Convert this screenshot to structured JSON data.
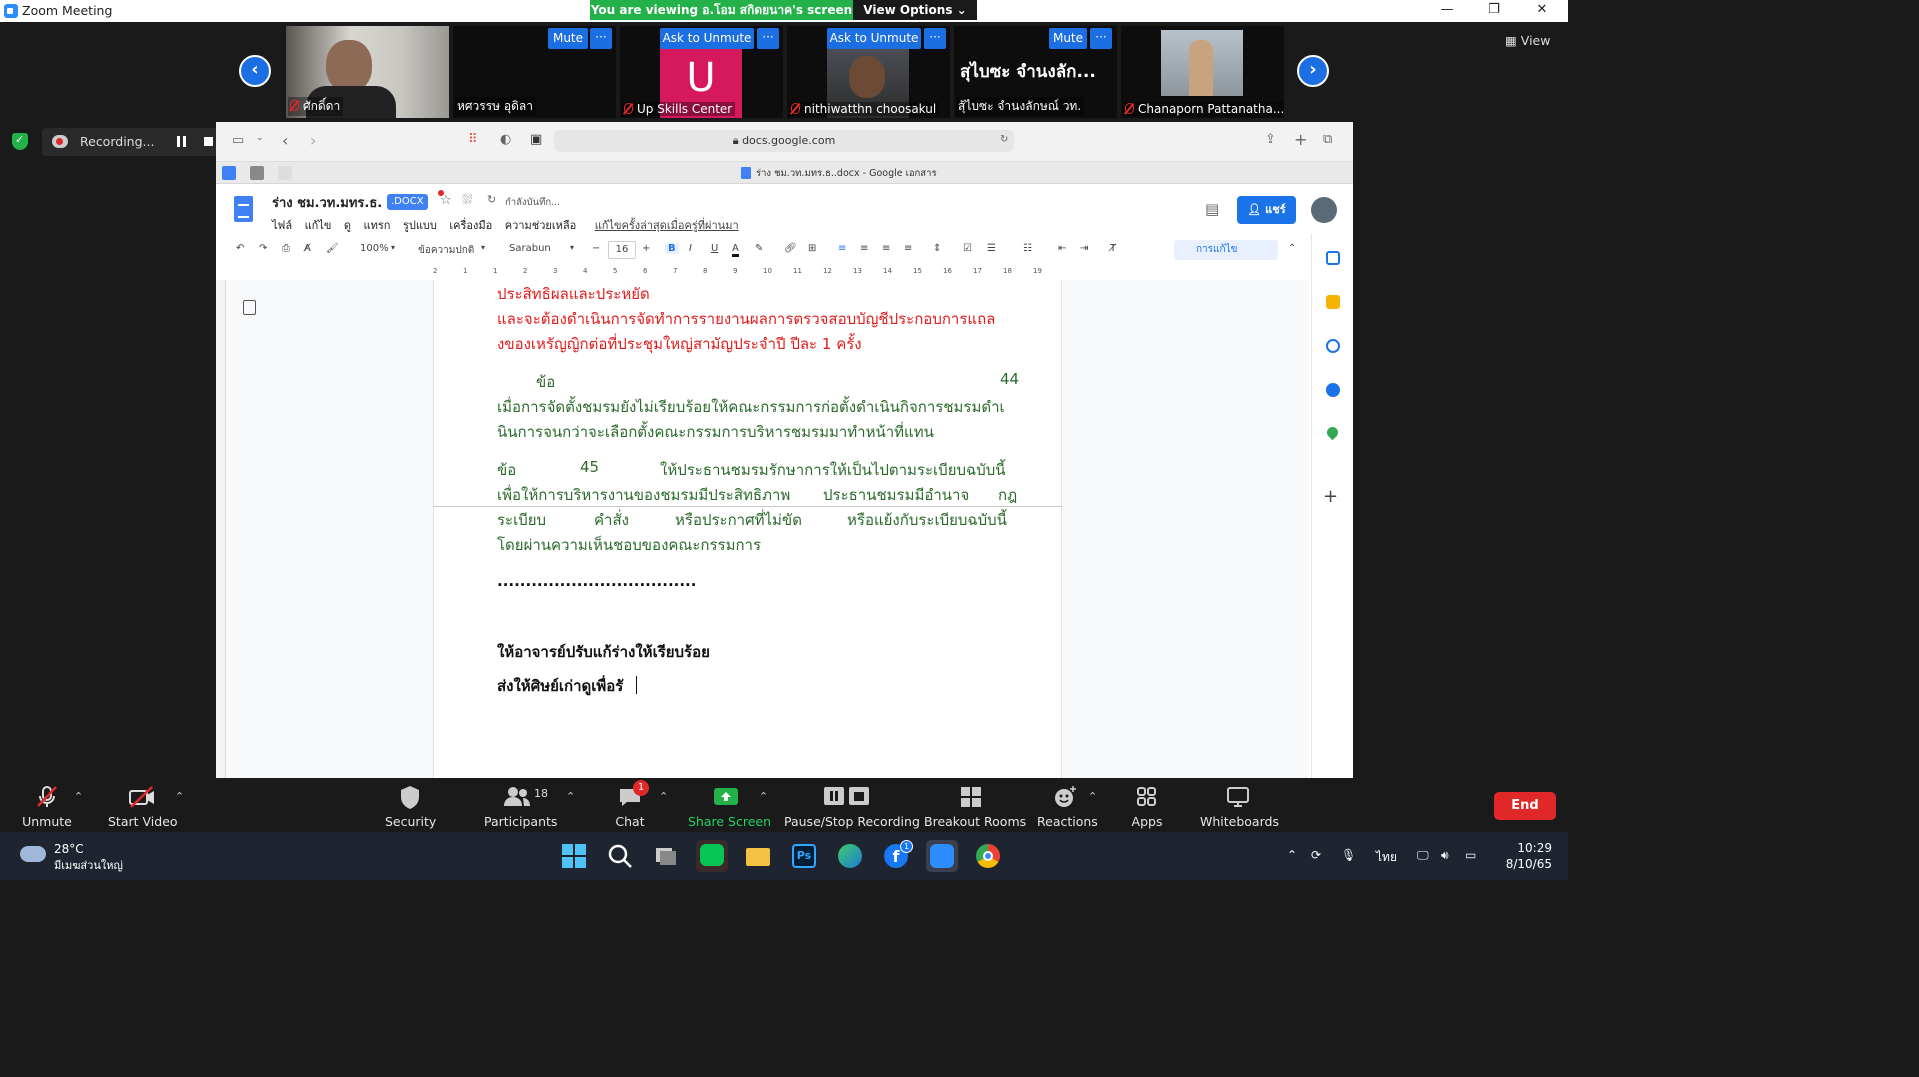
{
  "window": {
    "title": "Zoom Meeting",
    "minimize": "—",
    "restore": "❐",
    "close": "✕"
  },
  "share_banner": {
    "text": "You are viewing อ.โอม สกิดยนาค's screen",
    "view_options": "View Options ⌄"
  },
  "gallery": {
    "view_label": "View",
    "tiles": [
      {
        "name": "ศักดิ์ดา",
        "muted": true
      },
      {
        "name": "หศวรรษ อุดิลา",
        "muted": false,
        "button": "Mute"
      },
      {
        "name": "Up Skills Center",
        "muted": true,
        "button": "Ask to Unmute",
        "avatar_letter": "U"
      },
      {
        "name": "nithiwatthn choosakul",
        "muted": true,
        "button": "Ask to Unmute"
      },
      {
        "name": "สุ้ไบซะ จำนงลักษณ์ วท.",
        "muted": false,
        "button": "Mute",
        "big_name": "สุไบซะ จำนงลัก..."
      },
      {
        "name": "Chanaporn Pattanatha...",
        "muted": true
      }
    ],
    "more_label": "···"
  },
  "recording": {
    "label": "Recording..."
  },
  "browser": {
    "url": "docs.google.com",
    "tab_title": "ร่าง ชม.วท.มทร.ธ..docx - Google เอกสาร"
  },
  "docs": {
    "title": "ร่าง ชม.วท.มทร.ธ.",
    "badge": ".DOCX",
    "save_status": "กำลังบันทึก...",
    "menu": [
      "ไฟล์",
      "แก้ไข",
      "ดู",
      "แทรก",
      "รูปแบบ",
      "เครื่องมือ",
      "ความช่วยเหลือ"
    ],
    "last_edit": "แก้ไขครั้งล่าสุดเมื่อครู่ที่ผ่านมา",
    "share_label": "แชร์",
    "toolbar": {
      "zoom": "100%",
      "style": "ข้อความปกติ",
      "font": "Sarabun",
      "size": "16",
      "mode": "การแก้ไข"
    },
    "ruler_ticks": [
      "2",
      "1",
      "1",
      "2",
      "3",
      "4",
      "5",
      "6",
      "7",
      "8",
      "9",
      "10",
      "11",
      "12",
      "13",
      "14",
      "15",
      "16",
      "17",
      "18",
      "19"
    ],
    "content": {
      "red_lines": [
        "ประสิทธิผลและประหยัด",
        "และจะต้องดำเนินการจัดทำการรายงานผลการตรวจสอบบัญชีประกอบการแถล",
        "งของเหรัญญิกต่อที่ประชุมใหญ่สามัญประจำปี ปีละ 1 ครั้ง"
      ],
      "art44_word": "ข้อ",
      "art44_num": "44",
      "art44_lines": [
        "เมื่อการจัดตั้งชมรมยังไม่เรียบร้อยให้คณะกรรมการก่อตั้งดำเนินกิจการชมรมดำเ",
        "นินการจนกว่าจะเลือกตั้งคณะกรรมการบริหารชมรมมาทำหน้าที่แทน"
      ],
      "art45_word": "ข้อ",
      "art45_num": "45",
      "art45_first": "ให้ประธานชมรมรักษาการให้เป็นไปตามระเบียบฉบับนี้",
      "art45_line2a": "เพื่อให้การบริหารงานของชมรมมีประสิทธิภาพ",
      "art45_line2b": "ประธานชมรมมีอำนาจ",
      "art45_line2c": "กฎ",
      "art45_line3a": "ระเบียบ",
      "art45_line3b": "คำสั่ง",
      "art45_line3c": "หรือประกาศที่ไม่ขัด",
      "art45_line3d": "หรือแย้งกับระเบียบฉบับนี้",
      "art45_line4": "โดยผ่านความเห็นชอบของคณะกรรมการ",
      "dots": "...................................",
      "note1": "ให้อาจารย์ปรับแก้ร่างให้เรียบร้อย",
      "note2": "ส่งให้ศิษย์เก่าดูเพื่อรั"
    }
  },
  "zoom_toolbar": {
    "unmute": "Unmute",
    "start_video": "Start Video",
    "security": "Security",
    "participants": "Participants",
    "participants_count": "18",
    "chat": "Chat",
    "chat_badge": "1",
    "share_screen": "Share Screen",
    "pause_stop": "Pause/Stop Recording",
    "breakout": "Breakout Rooms",
    "reactions": "Reactions",
    "apps": "Apps",
    "whiteboards": "Whiteboards",
    "end": "End"
  },
  "taskbar": {
    "temp": "28°C",
    "weather": "มีเมฆส่วนใหญ่",
    "lang": "ไทย",
    "time": "10:29",
    "date": "8/10/65",
    "fb_badge": "1"
  },
  "colors": {
    "zoom_blue": "#1c6fe3",
    "share_green": "#25b14a",
    "end_red": "#e02828",
    "docs_red_text": "#e31b1b",
    "docs_green_text": "#2b6a2b"
  }
}
